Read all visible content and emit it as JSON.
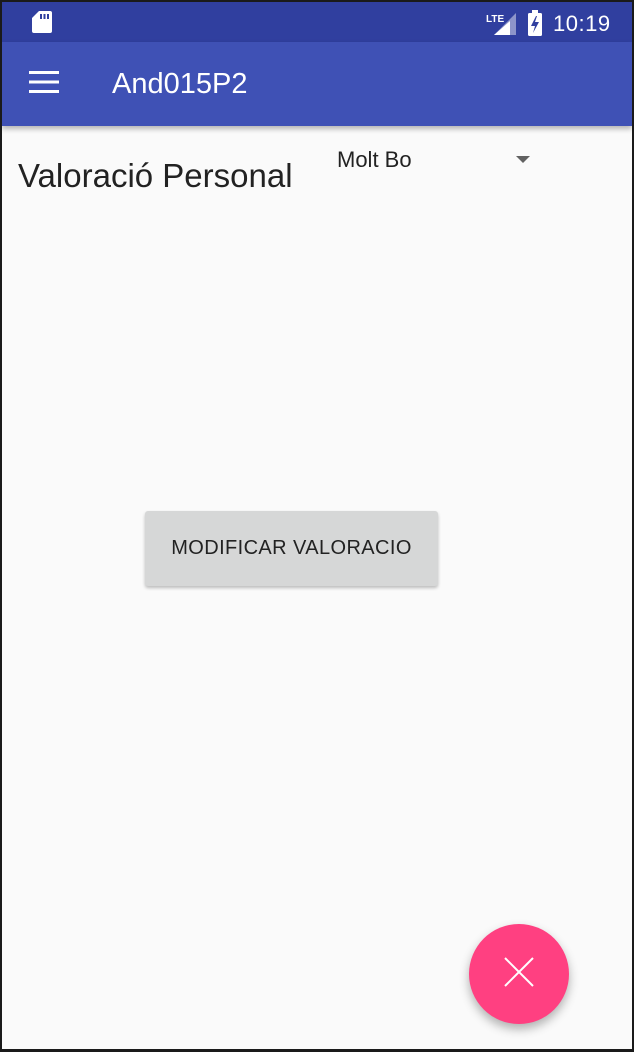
{
  "status_bar": {
    "time": "10:19",
    "network": "LTE",
    "icons": [
      "sd-card-icon",
      "lte-signal-icon",
      "battery-charging-icon"
    ]
  },
  "app_bar": {
    "title": "And015P2",
    "menu_icon": "menu-icon"
  },
  "content": {
    "heading": "Valoració Personal",
    "spinner": {
      "selected_value": "Molt Bo"
    },
    "modify_button_label": "MODIFICAR VALORACIO"
  },
  "fab": {
    "icon": "close-icon"
  },
  "colors": {
    "status_bar": "#303f9f",
    "primary": "#3f51b5",
    "accent": "#ff4081",
    "background": "#fafafa",
    "button": "#d6d7d7"
  }
}
